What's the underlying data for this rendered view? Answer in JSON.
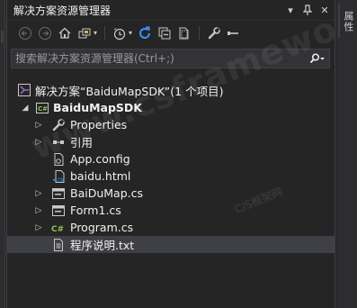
{
  "window": {
    "title": "解决方案资源管理器",
    "right_tab": "属性"
  },
  "search": {
    "placeholder": "搜索解决方案资源管理器(Ctrl+;)"
  },
  "tree": {
    "solution": "解决方案“BaiduMapSDK”(1 个项目)",
    "project": "BaiduMapSDK",
    "items": [
      {
        "label": "Properties",
        "icon": "wrench-icon"
      },
      {
        "label": "引用",
        "icon": "references-icon"
      },
      {
        "label": "App.config",
        "icon": "config-file-icon"
      },
      {
        "label": "baidu.html",
        "icon": "html-file-icon"
      },
      {
        "label": "BaiDuMap.cs",
        "icon": "form-icon"
      },
      {
        "label": "Form1.cs",
        "icon": "form-icon"
      },
      {
        "label": "Program.cs",
        "icon": "csharp-file-icon"
      },
      {
        "label": "程序说明.txt",
        "icon": "text-file-icon"
      }
    ]
  },
  "watermark": {
    "text": "www.csframework",
    "subtext": "C/S框架网"
  },
  "colors": {
    "background": "#252526",
    "accent_blue": "#3794ff",
    "selected": "#3f3f46",
    "csharp_green": "#8bc34a"
  }
}
